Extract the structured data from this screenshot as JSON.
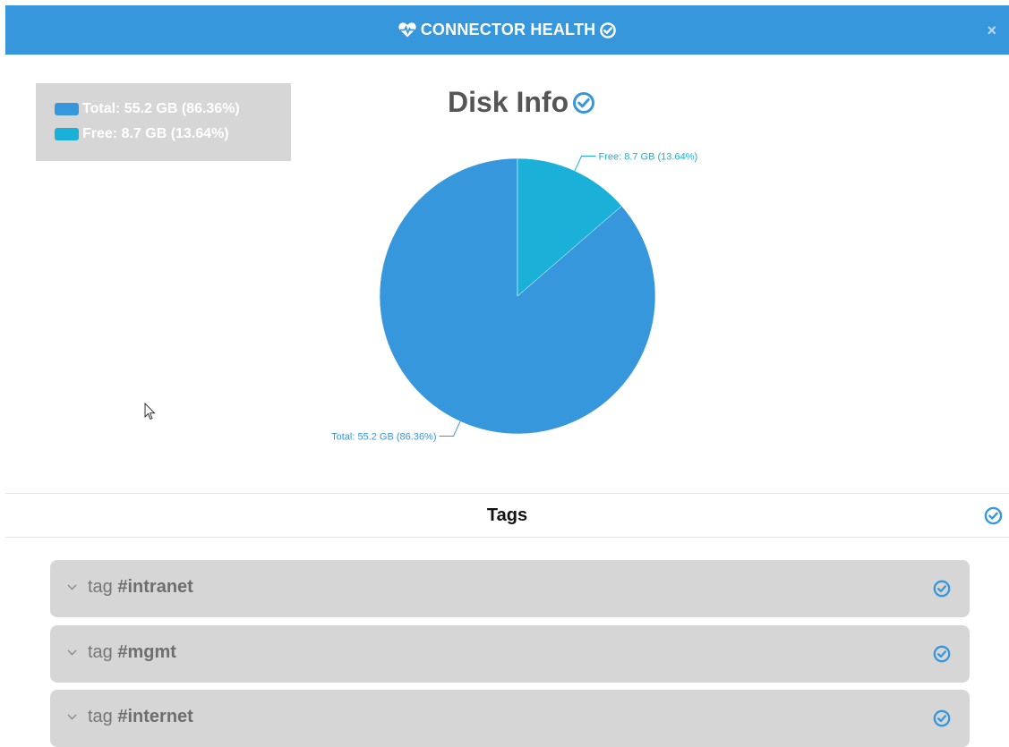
{
  "header": {
    "title": "CONNECTOR HEALTH",
    "close": "×"
  },
  "disk": {
    "title": "Disk Info",
    "legend": [
      {
        "label": "Total: 55.2 GB (86.36%)",
        "color": "#3797dc"
      },
      {
        "label": "Free: 8.7 GB (13.64%)",
        "color": "#1ab0d7"
      }
    ]
  },
  "chart_data": {
    "type": "pie",
    "title": "Disk Info",
    "slices": [
      {
        "label": "Total: 55.2 GB (86.36%)",
        "value": 86.36,
        "color": "#3797dc"
      },
      {
        "label": "Free: 8.7 GB (13.64%)",
        "value": 13.64,
        "color": "#1ab0d7"
      }
    ],
    "legend": "top-left"
  },
  "tags": {
    "title": "Tags",
    "items": [
      {
        "prefix": "tag ",
        "name": "#intranet"
      },
      {
        "prefix": "tag ",
        "name": "#mgmt"
      },
      {
        "prefix": "tag ",
        "name": "#internet"
      }
    ]
  }
}
